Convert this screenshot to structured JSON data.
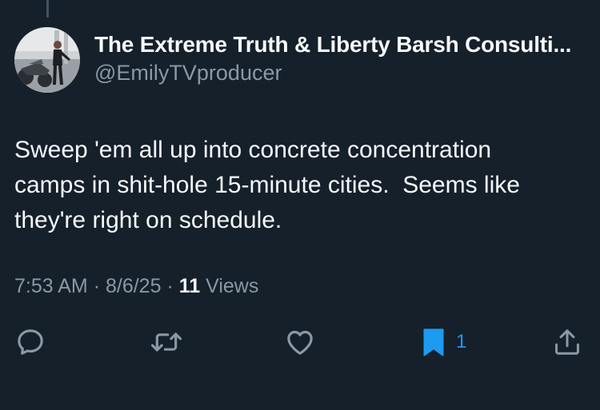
{
  "tweet": {
    "author": {
      "display_name": "The Extreme Truth & Liberty Barsh Consulti...",
      "handle": "@EmilyTVproducer"
    },
    "text": "Sweep 'em all up into concrete concentration\ncamps in shit-hole 15-minute cities.  Seems like\nthey're right on schedule.",
    "time": "7:53 AM",
    "separator": "·",
    "date": "8/6/25",
    "views_count": "11",
    "views_label": "Views"
  },
  "actions": {
    "reply_icon": "reply-icon",
    "retweet_icon": "retweet-icon",
    "like_icon": "heart-icon",
    "bookmark_icon": "bookmark-icon",
    "bookmark_count": "1",
    "share_icon": "share-icon"
  },
  "colors": {
    "background": "#15202b",
    "text_primary": "#f7f9f9",
    "text_secondary": "#8b98a5",
    "accent": "#1d9bf0"
  }
}
